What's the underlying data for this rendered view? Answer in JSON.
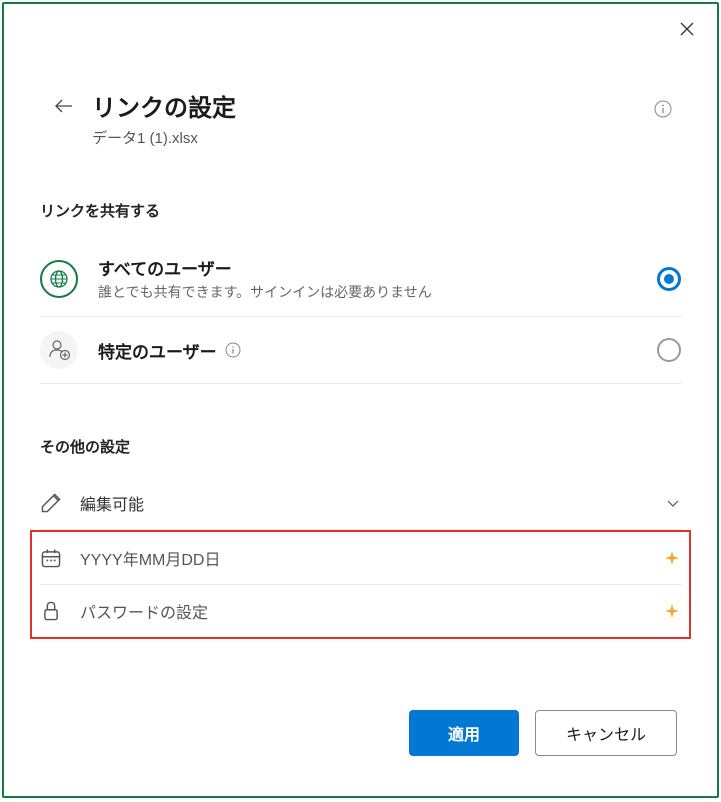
{
  "header": {
    "title": "リンクの設定",
    "subtitle": "データ1 (1).xlsx"
  },
  "share_section": {
    "label": "リンクを共有する",
    "options": {
      "everyone": {
        "title": "すべてのユーザー",
        "desc": "誰とでも共有できます。サインインは必要ありません"
      },
      "specific": {
        "title": "特定のユーザー"
      }
    }
  },
  "other_section": {
    "label": "その他の設定",
    "edit": "編集可能",
    "date_placeholder": "YYYY年MM月DD日",
    "password_placeholder": "パスワードの設定"
  },
  "footer": {
    "apply": "適用",
    "cancel": "キャンセル"
  }
}
